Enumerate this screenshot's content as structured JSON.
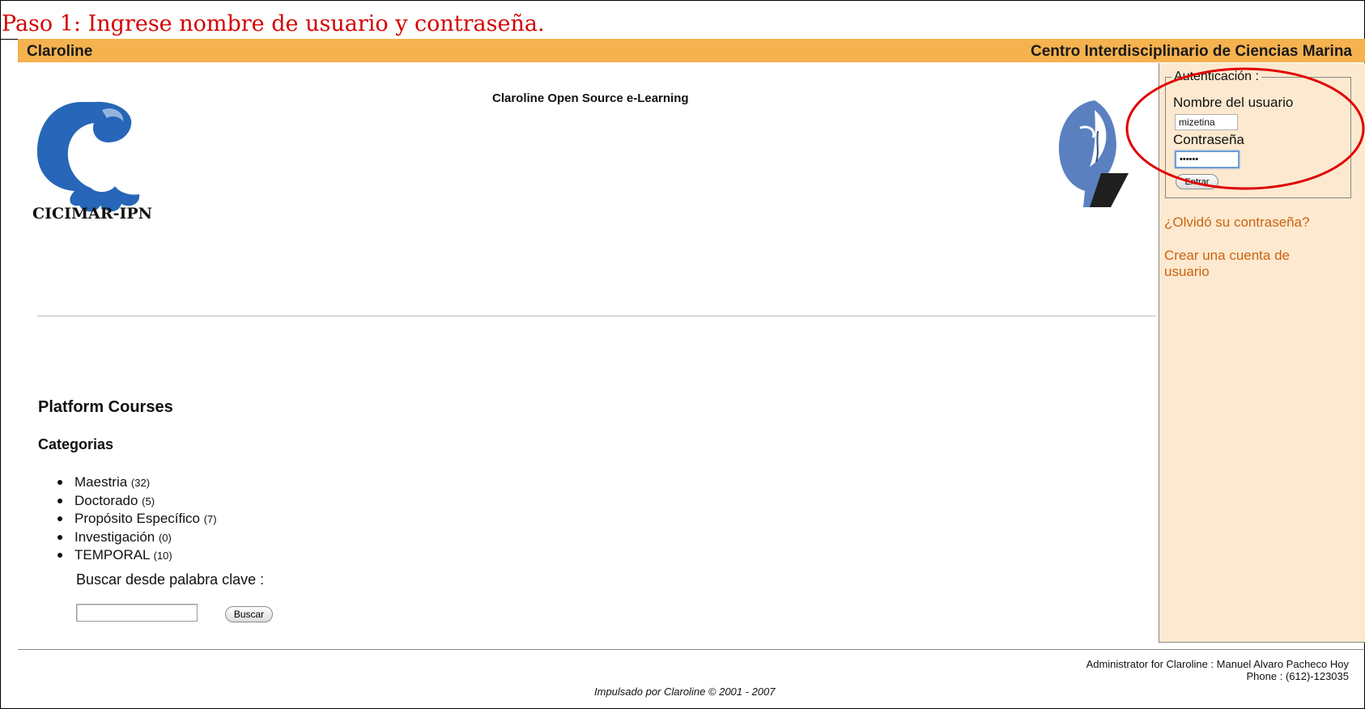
{
  "caption": "Paso 1: Ingrese nombre de usuario y contraseña.",
  "header": {
    "site_name": "Claroline",
    "institution": "Centro Interdisciplinario de Ciencias Marina"
  },
  "logo_text": "CICIMAR-IPN",
  "tagline": "Claroline Open Source e-Learning",
  "main": {
    "platform_title": "Platform Courses",
    "categories_title": "Categorias",
    "categories": [
      {
        "name": "Maestria",
        "count": "(32)"
      },
      {
        "name": "Doctorado",
        "count": "(5)"
      },
      {
        "name": "Propósito Específico",
        "count": "(7)"
      },
      {
        "name": "Investigación",
        "count": "(0)"
      },
      {
        "name": "TEMPORAL",
        "count": "(10)"
      }
    ],
    "search": {
      "label": "Buscar desde palabra clave :",
      "value": "",
      "button": "Buscar"
    }
  },
  "auth": {
    "legend": "Autenticación :",
    "username_label": "Nombre del usuario",
    "username_value": "mizetina",
    "password_label": "Contraseña",
    "password_value": "••••••",
    "submit": "Entrar"
  },
  "links": {
    "forgot_password": "¿Olvidó su contraseña?",
    "create_account": "Crear una cuenta de usuario"
  },
  "footer": {
    "admin": "Administrator for Claroline : Manuel Alvaro Pacheco Hoy",
    "phone": "Phone : (612)-123035",
    "powered_by": "Impulsado por Claroline © 2001 - 2007"
  },
  "colors": {
    "header_bar": "#f5b24f",
    "sidebar_bg": "#fde9cf",
    "link": "#c86414",
    "caption": "#d40000",
    "highlight_ellipse": "#e00000",
    "logo_blue": "#2766b8"
  }
}
